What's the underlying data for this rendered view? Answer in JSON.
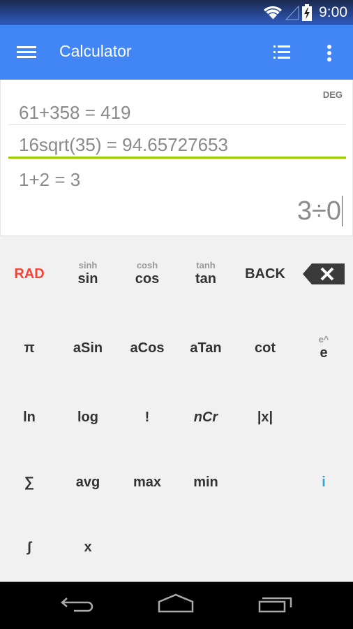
{
  "status_bar": {
    "time": "9:00",
    "icons": [
      "wifi-icon",
      "cell-signal-icon",
      "battery-charging-icon"
    ]
  },
  "app_bar": {
    "title": "Calculator",
    "icons": [
      "menu-icon",
      "history-list-icon",
      "more-vert-icon"
    ]
  },
  "display": {
    "angle_mode": "DEG",
    "history": [
      "61+358 = 419",
      "16sqrt(35) = 94.65727653",
      "1+2 = 3"
    ],
    "current_expression": "3÷0",
    "accent_line_color": "#99cc00"
  },
  "keypad": {
    "rows": [
      [
        {
          "main": "RAD",
          "sub": "",
          "color": "#f44336"
        },
        {
          "main": "sin",
          "sub": "sinh"
        },
        {
          "main": "cos",
          "sub": "cosh"
        },
        {
          "main": "tan",
          "sub": "tanh"
        },
        {
          "main": "BACK",
          "sub": ""
        },
        {
          "main": "",
          "sub": "",
          "icon": "backspace-icon"
        }
      ],
      [
        {
          "main": "π",
          "sub": ""
        },
        {
          "main": "aSin",
          "sub": ""
        },
        {
          "main": "aCos",
          "sub": ""
        },
        {
          "main": "aTan",
          "sub": ""
        },
        {
          "main": "cot",
          "sub": ""
        },
        {
          "main": "e",
          "sub": "e^"
        }
      ],
      [
        {
          "main": "ln",
          "sub": ""
        },
        {
          "main": "log",
          "sub": ""
        },
        {
          "main": "!",
          "sub": ""
        },
        {
          "main": "nCr",
          "sub": ""
        },
        {
          "main": "|x|",
          "sub": ""
        },
        {
          "main": "",
          "sub": ""
        }
      ],
      [
        {
          "main": "∑",
          "sub": ""
        },
        {
          "main": "avg",
          "sub": ""
        },
        {
          "main": "max",
          "sub": ""
        },
        {
          "main": "min",
          "sub": ""
        },
        {
          "main": "",
          "sub": ""
        },
        {
          "main": "i",
          "sub": "",
          "color": "#29a8e0"
        }
      ],
      [
        {
          "main": "∫",
          "sub": ""
        },
        {
          "main": "x",
          "sub": ""
        }
      ]
    ]
  },
  "nav_bar": {
    "icons": [
      "back-icon",
      "home-icon",
      "recents-icon"
    ]
  },
  "colors": {
    "app_bar": "#4285f4",
    "keypad_bg": "#f1f1f1",
    "rad_red": "#f44336",
    "imaginary_blue": "#29a8e0"
  }
}
